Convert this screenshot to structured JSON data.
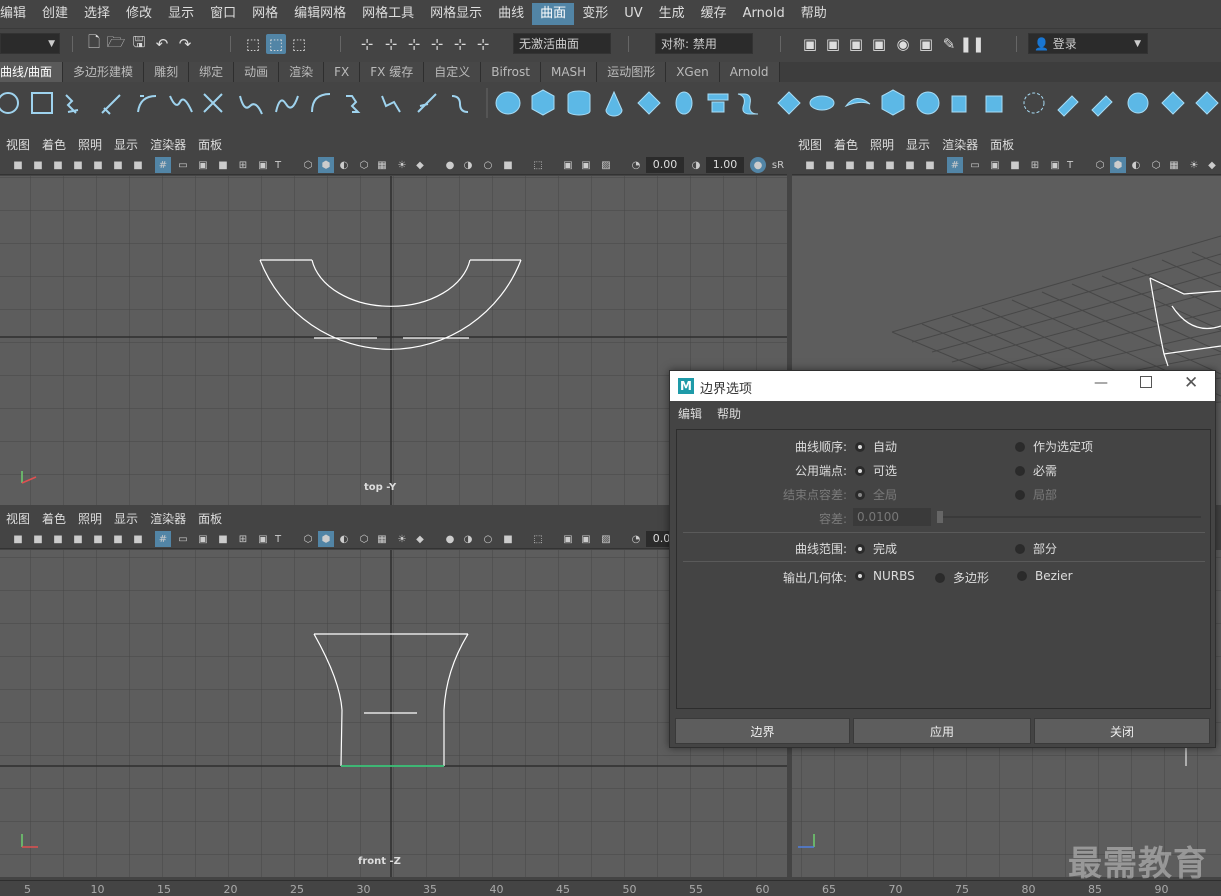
{
  "menubar": [
    "编辑",
    "创建",
    "选择",
    "修改",
    "显示",
    "窗口",
    "网格",
    "编辑网格",
    "网格工具",
    "网格显示",
    "曲线",
    "曲面",
    "变形",
    "UV",
    "生成",
    "缓存",
    "Arnold",
    "帮助"
  ],
  "menubar_active": "曲面",
  "statusline": {
    "inactive_surface": "无激活曲面",
    "symmetry": "对称: 禁用",
    "login": "登录"
  },
  "shelf_tabs": [
    "曲线/曲面",
    "多边形建模",
    "雕刻",
    "绑定",
    "动画",
    "渲染",
    "FX",
    "FX 缓存",
    "自定义",
    "Bifrost",
    "MASH",
    "运动图形",
    "XGen",
    "Arnold"
  ],
  "shelf_active": "曲线/曲面",
  "viewport_menu": [
    "视图",
    "着色",
    "照明",
    "显示",
    "渲染器",
    "面板"
  ],
  "viewport_values": {
    "exposure": "0.00",
    "gamma": "1.00"
  },
  "viewports": {
    "top": {
      "label": "top -Y"
    },
    "front": {
      "label": "front -Z"
    },
    "persp_short": "sR"
  },
  "timeline_ticks": [
    "5",
    "10",
    "15",
    "20",
    "25",
    "30",
    "35",
    "40",
    "45",
    "50",
    "55",
    "60",
    "65",
    "70",
    "75",
    "80",
    "85",
    "90"
  ],
  "dialog": {
    "title": "边界选项",
    "menu": [
      "编辑",
      "帮助"
    ],
    "rows": {
      "curve_order": {
        "label": "曲线顺序:",
        "options": [
          "自动",
          "作为选定项"
        ],
        "selected": 0
      },
      "common_endpoints": {
        "label": "公用端点:",
        "options": [
          "可选",
          "必需"
        ],
        "selected": 0
      },
      "end_point_tolerance": {
        "label": "结束点容差:",
        "options": [
          "全局",
          "局部"
        ],
        "selected": 0,
        "disabled": true
      },
      "tolerance": {
        "label": "容差:",
        "value": "0.0100",
        "disabled": true
      },
      "curve_range": {
        "label": "曲线范围:",
        "options": [
          "完成",
          "部分"
        ],
        "selected": 0
      },
      "output_geometry": {
        "label": "输出几何体:",
        "options": [
          "NURBS",
          "多边形",
          "Bezier"
        ],
        "selected": 0
      }
    },
    "buttons": {
      "apply_close": "边界",
      "apply": "应用",
      "close": "关闭"
    }
  },
  "watermark": "最需教育",
  "colors": {
    "accent": "#5285a6",
    "viewport_bg": "#5d5d5d",
    "curve_white": "#ffffff",
    "curve_green": "#3ddc84"
  }
}
